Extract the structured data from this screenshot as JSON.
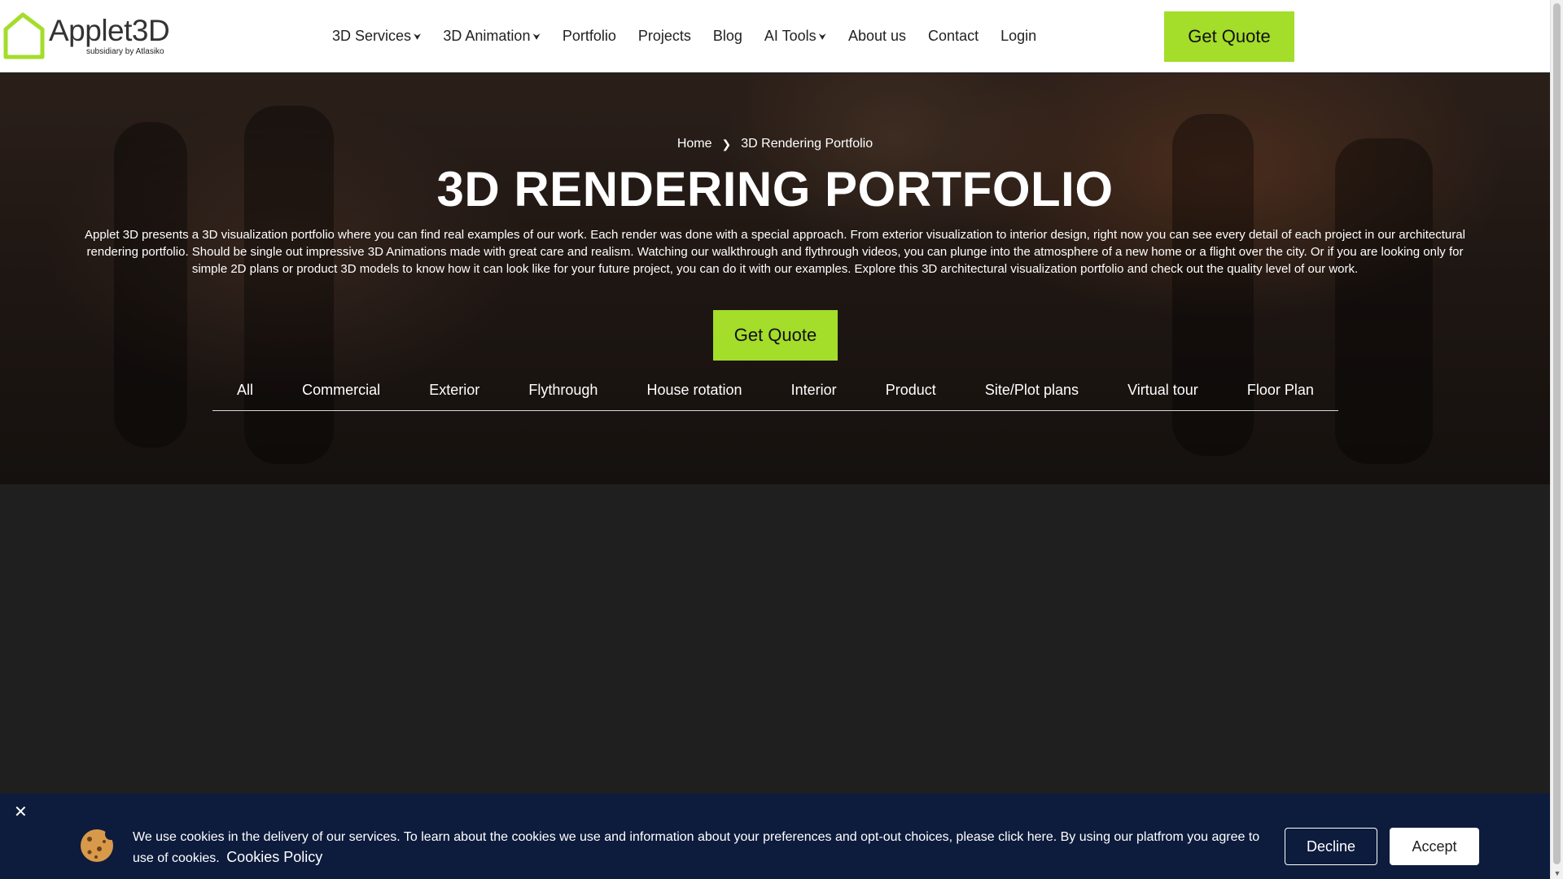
{
  "colors": {
    "accent": "#a4dd2a",
    "cookie_bg": "#0d1b3d",
    "content_bg": "#1f1f1f"
  },
  "header": {
    "logo": {
      "name": "Applet3D",
      "subtitle": "subsidiary by Atlasiko",
      "icon": "house-outline-logo-icon"
    },
    "nav": [
      {
        "label": "3D Services",
        "has_dropdown": true
      },
      {
        "label": "3D Animation",
        "has_dropdown": true
      },
      {
        "label": "Portfolio",
        "has_dropdown": false
      },
      {
        "label": "Projects",
        "has_dropdown": false
      },
      {
        "label": "Blog",
        "has_dropdown": false
      },
      {
        "label": "AI Tools",
        "has_dropdown": true
      },
      {
        "label": "About us",
        "has_dropdown": false
      },
      {
        "label": "Contact",
        "has_dropdown": false
      },
      {
        "label": "Login",
        "has_dropdown": false
      }
    ],
    "cta_label": "Get Quote"
  },
  "hero": {
    "breadcrumb": {
      "home": "Home",
      "current": "3D Rendering Portfolio",
      "separator_icon": "chevron-right-icon"
    },
    "title": "3D RENDERING PORTFOLIO",
    "description": "Applet 3D presents a 3D visualization portfolio where you can find real examples of our work. Each render was done with a special approach. From exterior visualization to interior design, right now you can see every detail of each project in our architectural rendering portfolio. Should be single out impressive 3D Animations made with great care and realism. Watching our walkthrough and flythrough videos, you can plunge into the atmosphere of a new home or a flight over the city. Or if you are looking only for simple 2D plans or product 3D models to know how it can look like for your future project, you can do it with our examples. Explore this 3D architectural visualization portfolio and check out the quality level of our work.",
    "cta_label": "Get Quote",
    "filters": [
      "All",
      "Commercial",
      "Exterior",
      "Flythrough",
      "House rotation",
      "Interior",
      "Product",
      "Site/Plot plans",
      "Virtual tour",
      "Floor Plan"
    ]
  },
  "cookie_banner": {
    "close_icon": "close-icon",
    "cookie_icon": "cookie-icon",
    "text": "We use cookies in the delivery of our services. To learn about the cookies we use and information about your preferences and opt-out choices, please click here. By using our platfrom you agree to use of cookies.",
    "policy_link": "Cookies Policy",
    "decline_label": "Decline",
    "accept_label": "Accept"
  }
}
